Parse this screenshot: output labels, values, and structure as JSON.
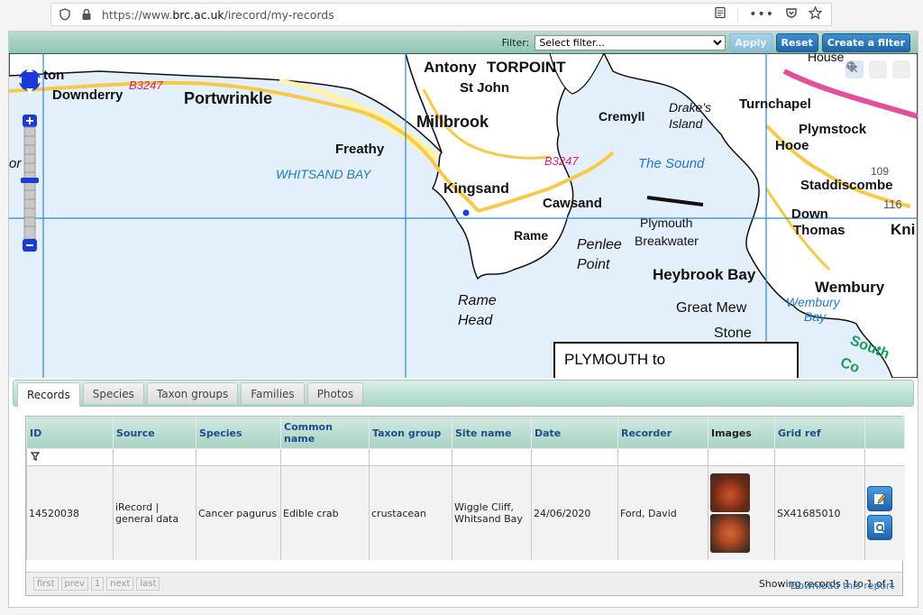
{
  "browser": {
    "url_prefix": "https://www.",
    "url_domain": "brc.ac.uk",
    "url_path": "/irecord/my-records"
  },
  "filter": {
    "label": "Filter:",
    "selected": "Select filter...",
    "apply_label": "Apply",
    "reset_label": "Reset",
    "create_label": "Create a filter"
  },
  "map": {
    "labels": [
      "ton",
      "Downderry",
      "B3247",
      "Portwrinkle",
      "Antony",
      "TORPOINT",
      "St John",
      "Millbrook",
      "Cremyll",
      "Drake's",
      "Island",
      "Turnchapel",
      "Plymstock",
      "Hooe",
      "Freathy",
      "WHITSAND BAY",
      "Kingsand",
      "Cawsand",
      "B3247",
      "The Sound",
      "Staddiscombe",
      "Plymouth",
      "Breakwater",
      "Down",
      "Thomas",
      "Kni",
      "Rame",
      "Penlee",
      "Point",
      "Heybrook Bay",
      "Wembury",
      "Rame",
      "Head",
      "Great Mew",
      "Stone",
      "Wembury",
      "Bay",
      "House",
      "109",
      "116",
      "or",
      "South",
      "Co"
    ],
    "legend_text": "PLYMOUTH to"
  },
  "tabs": [
    "Records",
    "Species",
    "Taxon groups",
    "Families",
    "Photos"
  ],
  "table": {
    "headers": [
      "ID",
      "Source",
      "Species",
      "Common name",
      "Taxon group",
      "Site name",
      "Date",
      "Recorder",
      "Images",
      "Grid ref"
    ],
    "row": {
      "id": "14520038",
      "source": "iRecord | general data",
      "species": "Cancer pagurus",
      "common_name": "Edible crab",
      "taxon_group": "crustacean",
      "site_name": "Wiggle Cliff, Whitsand Bay",
      "date": "24/06/2020",
      "recorder": "Ford, David",
      "grid_ref": "SX41685010"
    }
  },
  "pager": {
    "first": "first",
    "prev": "prev",
    "page": "1",
    "next": "next",
    "last": "last",
    "count": "Showing records 1 to 1 of 1"
  },
  "download_label": "Download this report",
  "colors": {
    "sea": "#e4effc",
    "land": "#ffffff",
    "road": "#f7c94b",
    "accent": "#1f66a8",
    "header_teal": "#a8d2c4"
  }
}
